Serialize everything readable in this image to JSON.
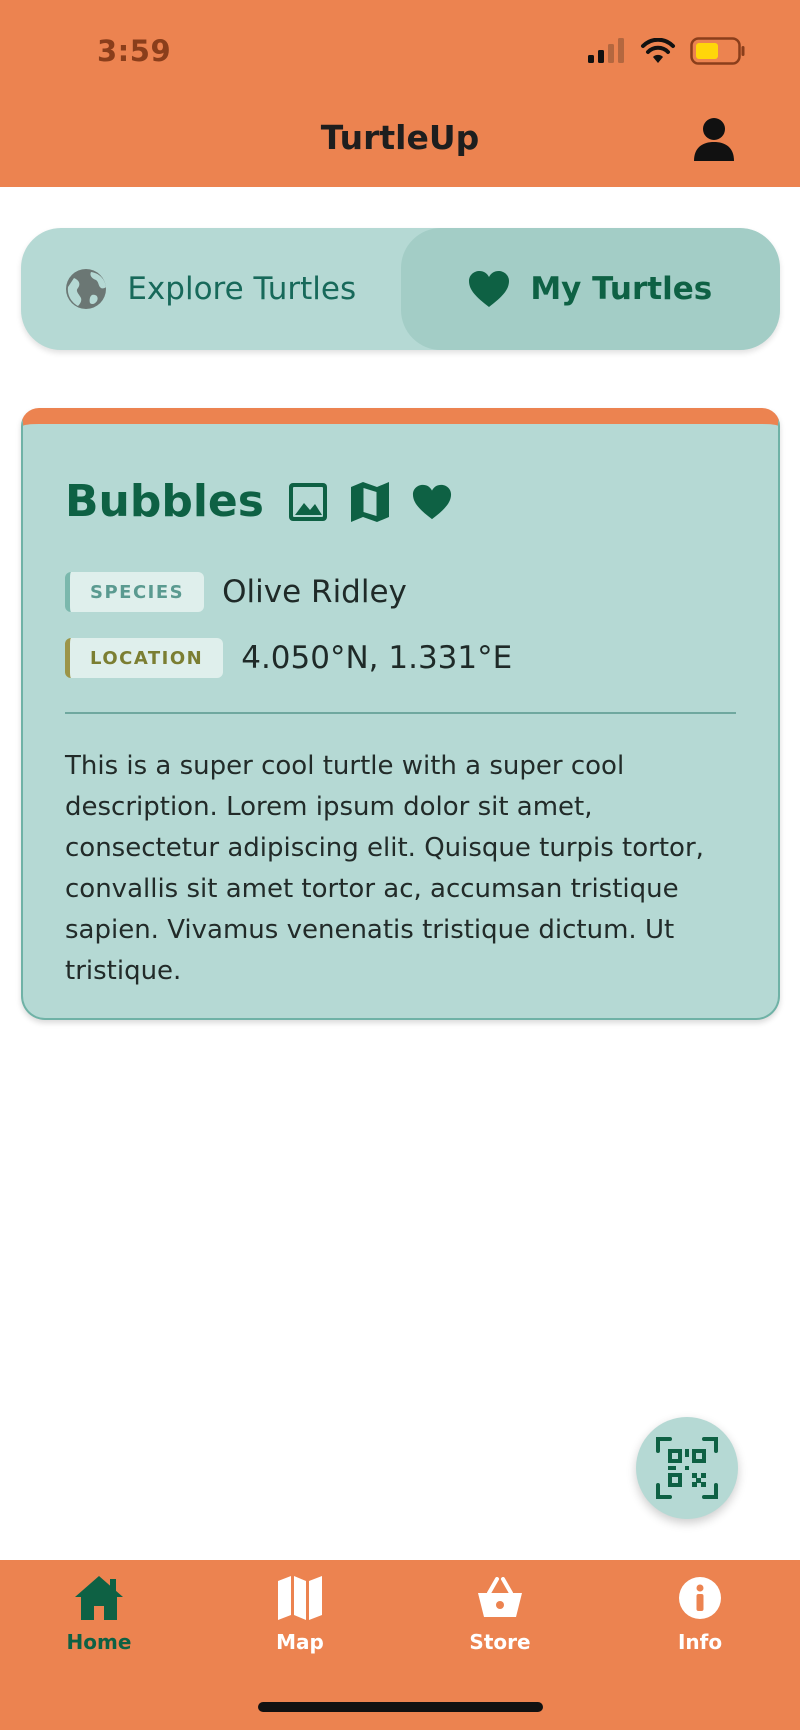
{
  "status_bar": {
    "time": "3:59"
  },
  "header": {
    "title": "TurtleUp",
    "profile_icon": "person-icon"
  },
  "tabs": [
    {
      "label": "Explore Turtles",
      "icon": "globe-icon",
      "selected": false
    },
    {
      "label": "My Turtles",
      "icon": "heart-icon",
      "selected": true
    }
  ],
  "turtle_card": {
    "name": "Bubbles",
    "action_icons": [
      "image-icon",
      "map-icon",
      "heart-icon"
    ],
    "species_label": "SPECIES",
    "species_value": "Olive Ridley",
    "location_label": "LOCATION",
    "location_value": "4.050°N, 1.331°E",
    "description": "This is a super cool turtle with a super cool description. Lorem ipsum dolor sit amet, consectetur adipiscing elit. Quisque turpis tortor, convallis sit amet tortor ac, accumsan tristique sapien. Vivamus venenatis tristique dictum. Ut tristique."
  },
  "fab": {
    "icon": "qr-scan-icon"
  },
  "bottom_nav": [
    {
      "label": "Home",
      "icon": "home-icon",
      "active": true
    },
    {
      "label": "Map",
      "icon": "map-icon",
      "active": false
    },
    {
      "label": "Store",
      "icon": "basket-icon",
      "active": false
    },
    {
      "label": "Info",
      "icon": "info-icon",
      "active": false
    }
  ],
  "colors": {
    "header": "#ec8350",
    "accent_green": "#0e6144",
    "card_bg": "#b5d9d4",
    "tab_selected_bg": "#a3cdc6"
  }
}
